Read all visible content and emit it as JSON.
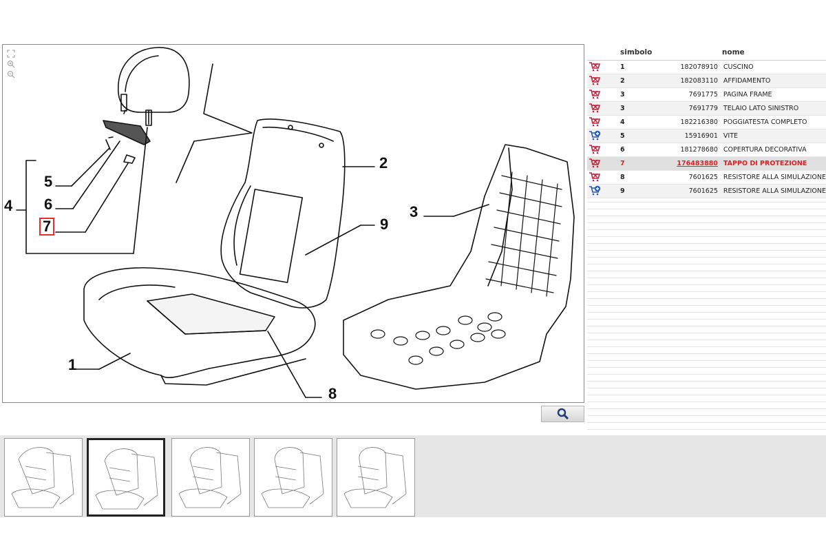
{
  "callouts": {
    "c1": "1",
    "c2": "2",
    "c3": "3",
    "c4": "4",
    "c5": "5",
    "c6": "6",
    "c7": "7",
    "c8": "8",
    "c9": "9"
  },
  "parts_table": {
    "headers": {
      "icon": "",
      "pos": "",
      "code": "simbolo",
      "name": "nome"
    },
    "rows": [
      {
        "icon": "cart-icon",
        "pos": "1",
        "code": "182078910",
        "name": "CUSCINO"
      },
      {
        "icon": "cart-icon",
        "pos": "2",
        "code": "182083110",
        "name": "AFFIDAMENTO"
      },
      {
        "icon": "cart-icon",
        "pos": "3",
        "code": "7691775",
        "name": "PAGINA FRAME"
      },
      {
        "icon": "cart-icon",
        "pos": "3",
        "code": "7691779",
        "name": "TELAIO LATO SINISTRO"
      },
      {
        "icon": "cart-icon",
        "pos": "4",
        "code": "182216380",
        "name": "POGGIATESTA COMPLETO"
      },
      {
        "icon": "cart-plus-icon",
        "pos": "5",
        "code": "15916901",
        "name": "VITE"
      },
      {
        "icon": "cart-icon",
        "pos": "6",
        "code": "181278680",
        "name": "COPERTURA DECORATIVA"
      },
      {
        "icon": "cart-icon",
        "pos": "7",
        "code": "176483880",
        "name": "TAPPO DI PROTEZIONE",
        "selected": true
      },
      {
        "icon": "cart-icon",
        "pos": "8",
        "code": "7601625",
        "name": "RESISTORE ALLA SIMULAZIONE"
      },
      {
        "icon": "cart-plus-icon",
        "pos": "9",
        "code": "7601625",
        "name": "RESISTORE ALLA SIMULAZIONE"
      }
    ]
  },
  "thumbnails": [
    {
      "name": "thumbnail-1",
      "active": false
    },
    {
      "name": "thumbnail-2",
      "active": true
    },
    {
      "name": "thumbnail-3",
      "active": false
    },
    {
      "name": "thumbnail-4",
      "active": false
    },
    {
      "name": "thumbnail-5",
      "active": false
    }
  ],
  "colors": {
    "highlight": "#e02020",
    "cart_red": "#c0203a",
    "cart_blue": "#2a58b8"
  }
}
